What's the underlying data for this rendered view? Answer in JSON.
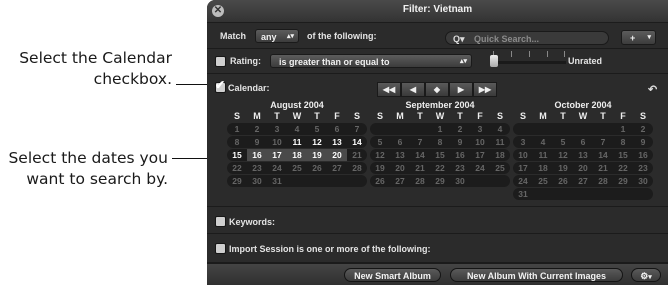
{
  "callouts": {
    "calendar": [
      "Select the Calendar",
      "checkbox."
    ],
    "dates": [
      "Select the dates you",
      "want to search by."
    ]
  },
  "window": {
    "title": "Filter: Vietnam",
    "close_icon": "close-icon"
  },
  "match_row": {
    "label_match": "Match",
    "popup_value": "any",
    "label_following": "of the following:",
    "search_placeholder": "Quick Search...",
    "add_button": "+"
  },
  "rating_row": {
    "label": "Rating:",
    "operator": "is greater than or equal to",
    "value_label": "Unrated",
    "checked": false
  },
  "calendar_row": {
    "label": "Calendar:",
    "checked": true,
    "nav_icons": [
      "double-left-icon",
      "left-icon",
      "diamond-icon",
      "right-icon",
      "double-right-icon"
    ],
    "nav_glyphs": [
      "◀◀",
      "◀",
      "◆",
      "▶",
      "▶▶"
    ],
    "undo_icon": "undo-icon"
  },
  "weekdays": [
    "S",
    "M",
    "T",
    "W",
    "T",
    "F",
    "S"
  ],
  "months": [
    {
      "title": "August 2004",
      "weeks": [
        [
          "1",
          "2",
          "3",
          "4",
          "5",
          "6",
          "7"
        ],
        [
          "8",
          "9",
          "10",
          "11",
          "12",
          "13",
          "14"
        ],
        [
          "15",
          "16",
          "17",
          "18",
          "19",
          "20",
          "21"
        ],
        [
          "22",
          "23",
          "24",
          "25",
          "26",
          "27",
          "28"
        ],
        [
          "29",
          "30",
          "31",
          "",
          "",
          "",
          ""
        ]
      ],
      "bright": [
        "11",
        "12",
        "13",
        "14",
        "15",
        "16",
        "17",
        "18",
        "19",
        "20"
      ],
      "selected": [
        "16",
        "17",
        "18",
        "19",
        "20"
      ]
    },
    {
      "title": "September 2004",
      "weeks": [
        [
          "",
          "",
          "",
          "1",
          "2",
          "3",
          "4"
        ],
        [
          "5",
          "6",
          "7",
          "8",
          "9",
          "10",
          "11"
        ],
        [
          "12",
          "13",
          "14",
          "15",
          "16",
          "17",
          "18"
        ],
        [
          "19",
          "20",
          "21",
          "22",
          "23",
          "24",
          "25"
        ],
        [
          "26",
          "27",
          "28",
          "29",
          "30",
          "",
          ""
        ]
      ],
      "bright": [],
      "selected": []
    },
    {
      "title": "October 2004",
      "weeks": [
        [
          "",
          "",
          "",
          "",
          "",
          "1",
          "2"
        ],
        [
          "3",
          "4",
          "5",
          "6",
          "7",
          "8",
          "9"
        ],
        [
          "10",
          "11",
          "12",
          "13",
          "14",
          "15",
          "16"
        ],
        [
          "17",
          "18",
          "19",
          "20",
          "21",
          "22",
          "23"
        ],
        [
          "24",
          "25",
          "26",
          "27",
          "28",
          "29",
          "30"
        ],
        [
          "31",
          "",
          "",
          "",
          "",
          "",
          ""
        ]
      ],
      "bright": [],
      "selected": []
    }
  ],
  "keywords_row": {
    "label": "Keywords:",
    "checked": false
  },
  "import_row": {
    "label": "Import Session is one or more of the following:",
    "checked": false
  },
  "bottom": {
    "new_smart_album": "New Smart Album",
    "new_album_current": "New Album With Current Images",
    "action_icon": "gear-icon"
  }
}
